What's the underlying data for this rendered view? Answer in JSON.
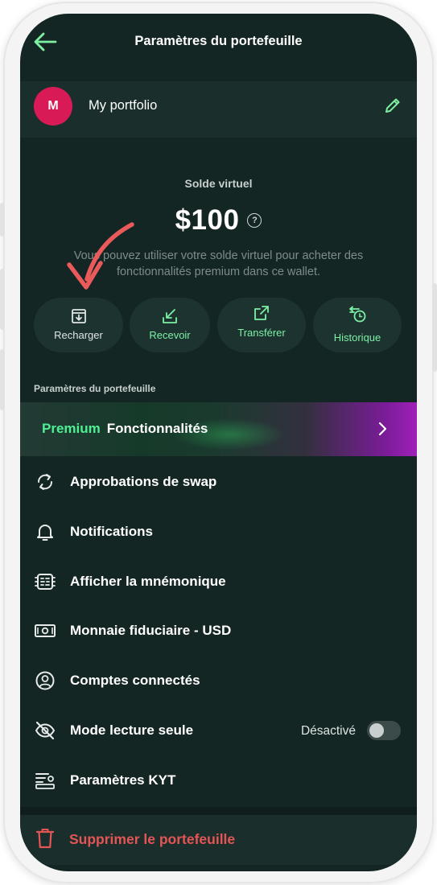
{
  "header": {
    "title": "Paramètres du portefeuille"
  },
  "portfolio": {
    "avatar_letter": "M",
    "name": "My portfolio"
  },
  "balance": {
    "label": "Solde virtuel",
    "value": "$100",
    "help_symbol": "?",
    "description": "Vous pouvez utiliser votre solde virtuel pour acheter des fonctionnalités premium dans ce wallet."
  },
  "actions": [
    {
      "label": "Recharger",
      "icon": "download-box-icon"
    },
    {
      "label": "Recevoir",
      "icon": "receive-arrow-icon"
    },
    {
      "label": "Transférer",
      "icon": "external-link-icon"
    },
    {
      "label": "Historique",
      "icon": "history-clock-icon"
    }
  ],
  "settings": {
    "section_title": "Paramètres du portefeuille",
    "premium": {
      "highlight": "Premium",
      "label": "Fonctionnalités"
    },
    "items": [
      {
        "label": "Approbations de swap",
        "icon": "swap-cycle-icon"
      },
      {
        "label": "Notifications",
        "icon": "bell-icon"
      },
      {
        "label": "Afficher la mnémonique",
        "icon": "mnemonic-icon"
      },
      {
        "label": "Monnaie fiduciaire - USD",
        "icon": "banknote-icon"
      },
      {
        "label": "Comptes connectés",
        "icon": "user-circle-icon"
      },
      {
        "label": "Mode lecture seule",
        "icon": "eye-off-icon",
        "toggle_text": "Désactivé",
        "toggle_on": false
      },
      {
        "label": "Paramètres KYT",
        "icon": "kyt-settings-icon"
      }
    ],
    "delete": {
      "label": "Supprimer le portefeuille",
      "icon": "trash-icon"
    }
  },
  "colors": {
    "background": "#142624",
    "accent_green": "#4ff093",
    "premium_purple": "#a020b8",
    "danger": "#e45555",
    "annotation_arrow": "#ea5a5a",
    "avatar": "#d81b57"
  }
}
